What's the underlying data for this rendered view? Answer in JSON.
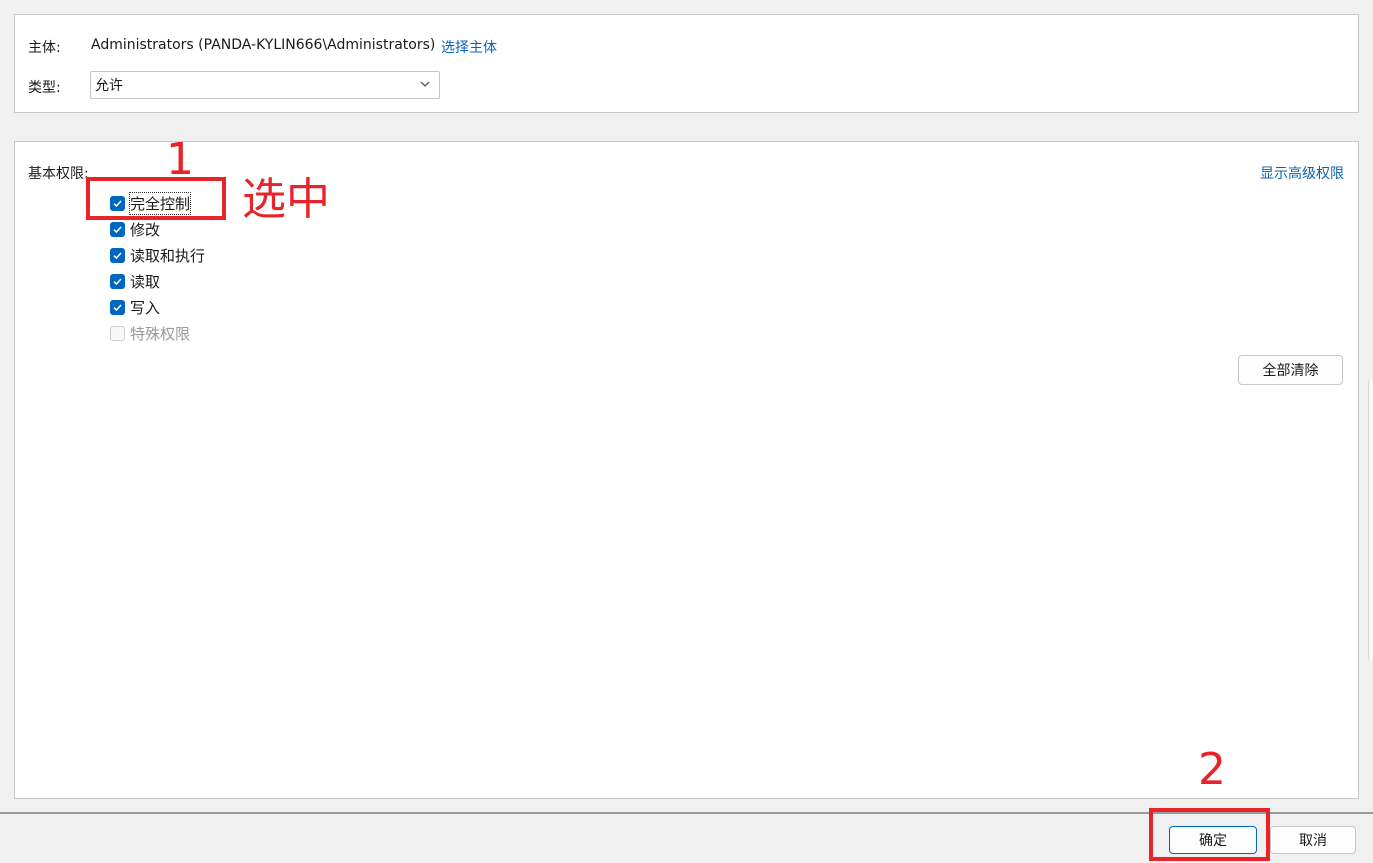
{
  "principal": {
    "label": "主体:",
    "value": "Administrators (PANDA-KYLIN666\\Administrators)",
    "select_link": "选择主体"
  },
  "type": {
    "label": "类型:",
    "selected": "允许"
  },
  "permissions": {
    "title": "基本权限:",
    "advanced_link": "显示高级权限",
    "items": [
      {
        "label": "完全控制",
        "checked": true
      },
      {
        "label": "修改",
        "checked": true
      },
      {
        "label": "读取和执行",
        "checked": true
      },
      {
        "label": "读取",
        "checked": true
      },
      {
        "label": "写入",
        "checked": true
      },
      {
        "label": "特殊权限",
        "checked": false
      }
    ],
    "clear_all": "全部清除"
  },
  "footer": {
    "ok": "确定",
    "cancel": "取消"
  },
  "annotations": {
    "step1_number": "1",
    "step1_text": "选中",
    "step2_number": "2",
    "color": "#e8242b"
  },
  "colors": {
    "accent": "#0067c0",
    "link": "#0a64b4"
  }
}
